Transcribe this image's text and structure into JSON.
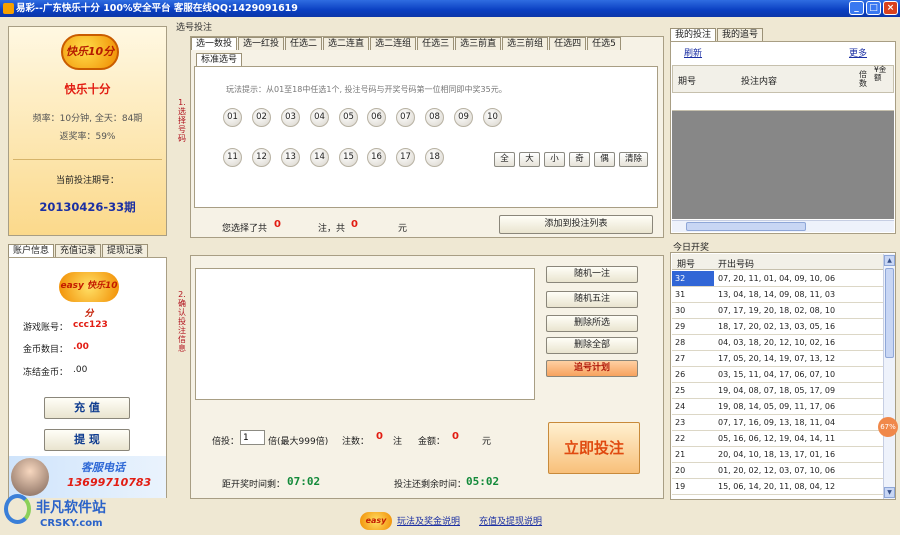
{
  "window": {
    "title": "易彩--广东快乐十分  100%安全平台   客服在线QQ:1429091619",
    "buttons": [
      "_",
      "□",
      "×"
    ]
  },
  "left_card": {
    "logo_text": "快乐10分",
    "game_name": "快乐十分",
    "frequency": "频率：10分钟, 全天：84期",
    "win_rate": "返奖率：59%",
    "current_issue_label": "当前投注期号：",
    "current_issue": "20130426-33期"
  },
  "account_tabs": [
    "账户信息",
    "充值记录",
    "提现记录"
  ],
  "account": {
    "logo_text": "easy 快乐10分",
    "user_label": "游戏账号：",
    "user_value": "ccc123",
    "gold_label": "金币数目：",
    "gold_value": ".00",
    "frozen_label": "冻结金币：",
    "frozen_value": ".00",
    "recharge_button": "充  值",
    "withdraw_button": "提  现",
    "service_label": "客服电话",
    "service_phone": "13699710783"
  },
  "watermark": {
    "cn": "非凡软件站",
    "en": "CRSKY.com"
  },
  "selection": {
    "section_label": "选号投注",
    "side_title": "1.选择号码",
    "play_tabs": [
      "选一数投",
      "选一红投",
      "任选二",
      "选二连直",
      "选二连组",
      "任选三",
      "选三前直",
      "选三前组",
      "任选四",
      "任选5"
    ],
    "sub_tab": "标准选号",
    "hint": "玩法提示：从01至18中任选1个, 投注号码与开奖号码第一位相同即中奖35元。",
    "numbers_row1": [
      "01",
      "02",
      "03",
      "04",
      "05",
      "06",
      "07",
      "08",
      "09",
      "10"
    ],
    "numbers_row2": [
      "11",
      "12",
      "13",
      "14",
      "15",
      "16",
      "17",
      "18"
    ],
    "quick_buttons": [
      "全",
      "大",
      "小",
      "奇",
      "偶",
      "清除"
    ],
    "summary_prefix": "您选择了共",
    "summary_count": "0",
    "summary_mid": "注，共",
    "summary_amount": "0",
    "summary_suffix": "元",
    "add_button": "添加到投注列表"
  },
  "confirm": {
    "side_title": "2.确认投注信息",
    "buttons": [
      "随机一注",
      "随机五注",
      "删除所选",
      "删除全部",
      "追号计划"
    ],
    "multiple_label": "倍投：",
    "multiple_value": "1",
    "multiple_hint": "倍(最大999倍)",
    "count_label": "注数：",
    "count_value": "0",
    "count_unit": "注",
    "money_label": "金额：",
    "money_value": "0",
    "money_unit": "元",
    "bet_button": "立即投注",
    "draw_time_label": "距开奖时间剩：",
    "draw_time_value": "07:02",
    "bet_time_label": "投注还剩余时间：",
    "bet_time_value": "05:02"
  },
  "my_bets": {
    "tabs": [
      "我的投注",
      "我的追号"
    ],
    "refresh": "刷新",
    "more": "更多",
    "columns": [
      "期号",
      "投注内容",
      "倍数",
      "¥金额"
    ]
  },
  "today": {
    "label": "今日开奖",
    "columns": [
      "期号",
      "开出号码"
    ],
    "rows": [
      {
        "issue": "32",
        "numbers": "07, 20, 11, 01, 04, 09, 10, 06"
      },
      {
        "issue": "31",
        "numbers": "13, 04, 18, 14, 09, 08, 11, 03"
      },
      {
        "issue": "30",
        "numbers": "07, 17, 19, 20, 18, 02, 08, 10"
      },
      {
        "issue": "29",
        "numbers": "18, 17, 20, 02, 13, 03, 05, 16"
      },
      {
        "issue": "28",
        "numbers": "04, 03, 18, 20, 12, 10, 02, 16"
      },
      {
        "issue": "27",
        "numbers": "17, 05, 20, 14, 19, 07, 13, 12"
      },
      {
        "issue": "26",
        "numbers": "03, 15, 11, 04, 17, 06, 07, 10"
      },
      {
        "issue": "25",
        "numbers": "19, 04, 08, 07, 18, 05, 17, 09"
      },
      {
        "issue": "24",
        "numbers": "19, 08, 14, 05, 09, 11, 17, 06"
      },
      {
        "issue": "23",
        "numbers": "07, 17, 16, 09, 13, 18, 11, 04"
      },
      {
        "issue": "22",
        "numbers": "05, 16, 06, 12, 19, 04, 14, 11"
      },
      {
        "issue": "21",
        "numbers": "20, 04, 10, 18, 13, 17, 01, 16"
      },
      {
        "issue": "20",
        "numbers": "01, 20, 02, 12, 03, 07, 10, 06"
      },
      {
        "issue": "19",
        "numbers": "15, 06, 14, 20, 11, 08, 04, 12"
      }
    ]
  },
  "footer": {
    "rules_link": "玩法及奖金说明",
    "recharge_link": "充值及提现说明",
    "logo_text": "easy"
  },
  "progress_bubble": "67%"
}
